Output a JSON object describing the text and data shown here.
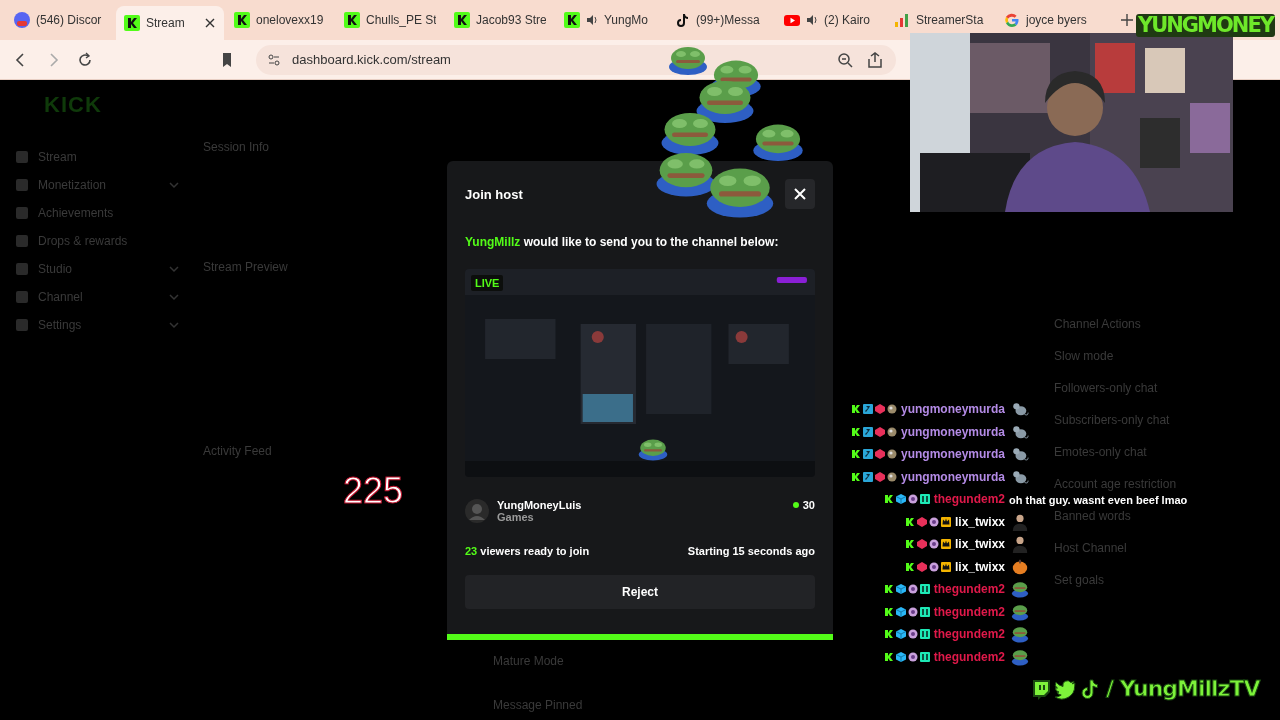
{
  "browser": {
    "tabs": [
      {
        "label": "(546) Discor",
        "kind": "discord",
        "selected": false,
        "audio": false
      },
      {
        "label": "Stream",
        "kind": "kick",
        "selected": true,
        "audio": false
      },
      {
        "label": "onelovexx19",
        "kind": "kick",
        "selected": false,
        "audio": false
      },
      {
        "label": "Chulls_PE St",
        "kind": "kick",
        "selected": false,
        "audio": false
      },
      {
        "label": "Jacob93 Stre",
        "kind": "kick",
        "selected": false,
        "audio": false
      },
      {
        "label": "YungMo",
        "kind": "kick",
        "selected": false,
        "audio": true
      },
      {
        "label": "(99+)Messa",
        "kind": "tiktok",
        "selected": false,
        "audio": false
      },
      {
        "label": "(2) Kairo",
        "kind": "youtube",
        "selected": false,
        "audio": true
      },
      {
        "label": "StreamerSta",
        "kind": "bars",
        "selected": false,
        "audio": false
      },
      {
        "label": "joyce byers",
        "kind": "google",
        "selected": false,
        "audio": false
      }
    ],
    "url": "dashboard.kick.com/stream"
  },
  "dashboard": {
    "logo": "KICK",
    "sidebar": [
      {
        "label": "Stream",
        "expandable": false
      },
      {
        "label": "Monetization",
        "expandable": true
      },
      {
        "label": "Achievements",
        "expandable": false
      },
      {
        "label": "Drops & rewards",
        "expandable": false
      },
      {
        "label": "Studio",
        "expandable": true
      },
      {
        "label": "Channel",
        "expandable": true
      },
      {
        "label": "Settings",
        "expandable": true
      }
    ],
    "left_panels": [
      "Session Info",
      "Stream Preview",
      "Activity Feed"
    ],
    "center_items": [
      "Mature Mode",
      "Message Pinned"
    ],
    "channel_actions": {
      "title": "Channel Actions",
      "items": [
        "Slow mode",
        "Followers-only chat",
        "Subscribers-only chat",
        "Emotes-only chat",
        "Account age restriction",
        "Banned words",
        "Host Channel",
        "Set goals"
      ]
    }
  },
  "modal": {
    "title": "Join host",
    "inviter": "YungMillz",
    "message": "would like to send you to the channel below:",
    "live_badge": "LIVE",
    "channel": {
      "name": "YungMoneyLuis",
      "category": "Games",
      "viewers": "30"
    },
    "ready_count": "23",
    "ready_text": "viewers ready to join",
    "starting": "Starting 15 seconds ago",
    "reject": "Reject",
    "progress": {
      "level": 1
    }
  },
  "overlay": {
    "counter": "225",
    "logo": "YUNGMONEY",
    "social": "/ YungMillzTV",
    "chat": [
      {
        "user": "yungmoneymurda",
        "color": "#b48be6",
        "kind": "mod_rat"
      },
      {
        "user": "yungmoneymurda",
        "color": "#b48be6",
        "kind": "mod_rat"
      },
      {
        "user": "yungmoneymurda",
        "color": "#b48be6",
        "kind": "mod_rat"
      },
      {
        "user": "yungmoneymurda",
        "color": "#b48be6",
        "kind": "mod_rat"
      },
      {
        "user": "thegundem2",
        "color": "#e0194a",
        "kind": "gundem_text",
        "message": "oh that guy. wasnt even beef lmao"
      },
      {
        "user": "lix_twixx",
        "color": "#ffffff",
        "kind": "lix_person"
      },
      {
        "user": "lix_twixx",
        "color": "#ffffff",
        "kind": "lix_person"
      },
      {
        "user": "lix_twixx",
        "color": "#ffffff",
        "kind": "lix_pumpkin"
      },
      {
        "user": "thegundem2",
        "color": "#e0194a",
        "kind": "gundem_frog"
      },
      {
        "user": "thegundem2",
        "color": "#e0194a",
        "kind": "gundem_frog"
      },
      {
        "user": "thegundem2",
        "color": "#e0194a",
        "kind": "gundem_frog"
      },
      {
        "user": "thegundem2",
        "color": "#e0194a",
        "kind": "gundem_frog"
      }
    ]
  }
}
